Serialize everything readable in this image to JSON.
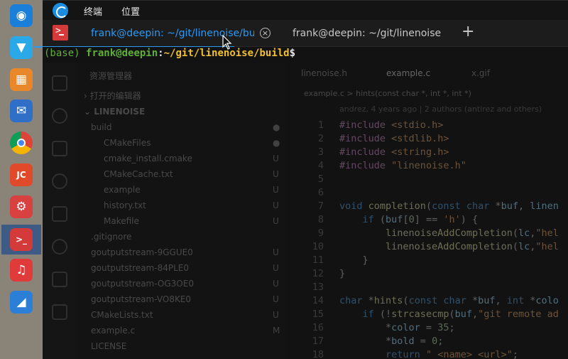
{
  "dock": {
    "items": [
      {
        "name": "deepin-launcher",
        "color": "#1a7fd8",
        "glyph": "◉"
      },
      {
        "name": "app-store",
        "color": "#2aa8e8",
        "glyph": "▼"
      },
      {
        "name": "file-archiver",
        "color": "#e8882b",
        "glyph": "▦"
      },
      {
        "name": "thunderbird",
        "color": "#2f6fc8",
        "glyph": "✉"
      },
      {
        "name": "chrome",
        "color": "#e0e0e0",
        "glyph": "●"
      },
      {
        "name": "jetbrains",
        "color": "#e04a2a",
        "glyph": "JC"
      },
      {
        "name": "settings",
        "color": "#d94040",
        "glyph": "⚙"
      },
      {
        "name": "deepin-terminal",
        "color": "#d43a3a",
        "glyph": ">_"
      },
      {
        "name": "netease-music",
        "color": "#e03a3a",
        "glyph": "♫"
      },
      {
        "name": "vscode",
        "color": "#2b7fd6",
        "glyph": "◢"
      }
    ]
  },
  "titlebar": {
    "menu": [
      "终端",
      "位置"
    ]
  },
  "tabs": [
    {
      "label": "frank@deepin: ~/git/linenoise/bui",
      "active": true
    },
    {
      "label": "frank@deepin: ~/git/linenoise",
      "active": false
    }
  ],
  "terminal": {
    "prompt": {
      "env": "(base) ",
      "user_host": "frank@deepin",
      "colon": ":",
      "path": "~/git/linenoise/build",
      "dollar": "$"
    }
  },
  "background_editor": {
    "explorer_title": "资源管理器",
    "open_editors": "打开的编辑器",
    "project": "LINENOISE",
    "tree": [
      {
        "label": "build",
        "flag": "●",
        "indent": 1
      },
      {
        "label": "CMakeFiles",
        "flag": "●",
        "indent": 2
      },
      {
        "label": "cmake_install.cmake",
        "flag": "U",
        "indent": 2
      },
      {
        "label": "CMakeCache.txt",
        "flag": "U",
        "indent": 2
      },
      {
        "label": "example",
        "flag": "U",
        "indent": 2
      },
      {
        "label": "history.txt",
        "flag": "U",
        "indent": 2
      },
      {
        "label": "Makefile",
        "flag": "U",
        "indent": 2
      },
      {
        "label": ".gitignore",
        "flag": "",
        "indent": 1
      },
      {
        "label": "goutputstream-9GGUE0",
        "flag": "U",
        "indent": 1
      },
      {
        "label": "goutputstream-84PLE0",
        "flag": "U",
        "indent": 1
      },
      {
        "label": "goutputstream-OG3OE0",
        "flag": "U",
        "indent": 1
      },
      {
        "label": "goutputstream-VO8KE0",
        "flag": "U",
        "indent": 1
      },
      {
        "label": "CMakeLists.txt",
        "flag": "U",
        "indent": 1
      },
      {
        "label": "example.c",
        "flag": "M",
        "indent": 1
      },
      {
        "label": "LICENSE",
        "flag": "",
        "indent": 1
      }
    ],
    "editor_tabs": [
      "linenoise.h",
      "example.c",
      "x.gif"
    ],
    "breadcrumb": "example.c > hints(const char *, int *, int *)",
    "blame": "andrez, 4 years ago | 2 authors (antirez and others)",
    "code": [
      {
        "n": "1",
        "html": "<span class='pp'>#include</span> <span class='str'>&lt;stdio.h&gt;</span>"
      },
      {
        "n": "2",
        "html": "<span class='pp'>#include</span> <span class='str'>&lt;stdlib.h&gt;</span>"
      },
      {
        "n": "3",
        "html": "<span class='pp'>#include</span> <span class='str'>&lt;string.h&gt;</span>"
      },
      {
        "n": "4",
        "html": "<span class='pp'>#include</span> <span class='str'>\"linenoise.h\"</span>"
      },
      {
        "n": "5",
        "html": ""
      },
      {
        "n": "6",
        "html": ""
      },
      {
        "n": "7",
        "html": "<span class='kw'>void</span> <span class='fn'>completion</span>(<span class='kw'>const char</span> *<span class='id'>buf</span>, <span class='id'>linen</span>"
      },
      {
        "n": "8",
        "html": "    <span class='kw'>if</span> (<span class='id'>buf</span>[<span class='num'>0</span>] == <span class='str'>'h'</span>) {"
      },
      {
        "n": "9",
        "html": "        <span class='fn'>linenoiseAddCompletion</span>(<span class='id'>lc</span>,<span class='str'>\"hel</span>"
      },
      {
        "n": "10",
        "html": "        <span class='fn'>linenoiseAddCompletion</span>(<span class='id'>lc</span>,<span class='str'>\"hel</span>"
      },
      {
        "n": "11",
        "html": "    }"
      },
      {
        "n": "12",
        "html": "}"
      },
      {
        "n": "13",
        "html": ""
      },
      {
        "n": "14",
        "html": "<span class='kw'>char</span> *<span class='fn'>hints</span>(<span class='kw'>const char</span> *<span class='id'>buf</span>, <span class='kw'>int</span> *<span class='id'>colo</span>"
      },
      {
        "n": "15",
        "html": "    <span class='kw'>if</span> (!<span class='fn'>strcasecmp</span>(<span class='id'>buf</span>,<span class='str'>\"git remote ad</span>"
      },
      {
        "n": "16",
        "html": "        *<span class='id'>color</span> = <span class='num'>35</span>;"
      },
      {
        "n": "17",
        "html": "        *<span class='id'>bold</span> = <span class='num'>0</span>;"
      },
      {
        "n": "18",
        "html": "        <span class='kw'>return</span> <span class='str'>\" &lt;name&gt; &lt;url&gt;\"</span>;"
      }
    ]
  }
}
